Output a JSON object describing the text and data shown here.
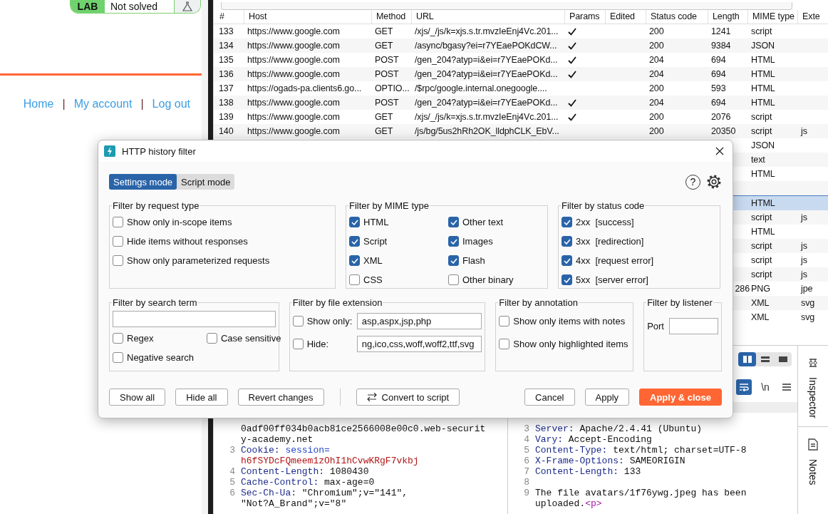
{
  "lab_banner": {
    "label": "LAB",
    "status": "Not solved"
  },
  "site_nav": [
    {
      "kind": "link",
      "label": "Home"
    },
    {
      "kind": "separator",
      "label": "|"
    },
    {
      "kind": "link",
      "label": "My account"
    },
    {
      "kind": "separator",
      "label": "|"
    },
    {
      "kind": "link",
      "label": "Log out"
    }
  ],
  "proxy_table": {
    "columns": [
      "#",
      "Host",
      "Method",
      "URL",
      "Params",
      "Edited",
      "Status code",
      "Length",
      "MIME type",
      "Exte"
    ],
    "rows": [
      {
        "num": "133",
        "host": "https://www.google.com",
        "method": "GET",
        "url": "/xjs/_/js/k=xjs.s.tr.mvzIeEnj4Vc.201...",
        "params": true,
        "status": "200",
        "length": "1241",
        "mime": "script",
        "selected": false
      },
      {
        "num": "134",
        "host": "https://www.google.com",
        "method": "GET",
        "url": "/async/bgasy?ei=r7YEaePOKdCW...",
        "params": true,
        "status": "200",
        "length": "9384",
        "mime": "JSON",
        "selected": false
      },
      {
        "num": "135",
        "host": "https://www.google.com",
        "method": "POST",
        "url": "/gen_204?atyp=i&ei=r7YEaePOKd...",
        "params": true,
        "status": "204",
        "length": "694",
        "mime": "HTML",
        "selected": false
      },
      {
        "num": "136",
        "host": "https://www.google.com",
        "method": "POST",
        "url": "/gen_204?atyp=i&ei=r7YEaePOKd...",
        "params": true,
        "status": "204",
        "length": "694",
        "mime": "HTML",
        "selected": false
      },
      {
        "num": "137",
        "host": "https://ogads-pa.clients6.go...",
        "method": "OPTIO...",
        "url": "/$rpc/google.internal.onegoogle....",
        "params": false,
        "status": "200",
        "length": "593",
        "mime": "HTML",
        "selected": false
      },
      {
        "num": "138",
        "host": "https://www.google.com",
        "method": "POST",
        "url": "/gen_204?atyp=i&ei=r7YEaePOKd...",
        "params": true,
        "status": "204",
        "length": "694",
        "mime": "HTML",
        "selected": false
      },
      {
        "num": "139",
        "host": "https://www.google.com",
        "method": "GET",
        "url": "/xjs/_/js/k=xjs.s.tr.mvzIeEnj4Vc.201...",
        "params": true,
        "status": "200",
        "length": "2076",
        "mime": "script",
        "selected": false
      },
      {
        "num": "140",
        "host": "https://www.google.com",
        "method": "GET",
        "url": "/js/bg/5us2hRh2OK_lldphCLK_EbV...",
        "params": false,
        "status": "200",
        "length": "20350",
        "mime": "script",
        "ext": "js",
        "selected": false
      },
      {
        "mime": "JSON",
        "selected": false
      },
      {
        "mime": "text",
        "selected": false
      },
      {
        "mime": "HTML",
        "selected": false
      },
      {
        "selected": false
      },
      {
        "mime": "HTML",
        "selected": true
      },
      {
        "mime": "script",
        "ext": "js",
        "selected": false
      },
      {
        "mime": "HTML",
        "selected": false
      },
      {
        "mime": "script",
        "ext": "js",
        "selected": false
      },
      {
        "mime": "script",
        "ext": "js",
        "selected": false
      },
      {
        "mime": "script",
        "ext": "js",
        "selected": false
      },
      {
        "length": "286",
        "mime": "PNG",
        "ext": "jpe",
        "selected": false
      },
      {
        "mime": "XML",
        "ext": "svg",
        "selected": false
      },
      {
        "mime": "XML",
        "ext": "svg",
        "selected": false
      }
    ]
  },
  "view_toolbar": [
    {
      "kind": "columns",
      "selected": true
    },
    {
      "kind": "rows",
      "selected": false
    },
    {
      "kind": "single",
      "selected": false
    }
  ],
  "editor_toolbar": [
    {
      "kind": "wrap",
      "selected": true
    },
    {
      "kind": "text",
      "label": "\\n",
      "selected": false
    },
    {
      "kind": "menu",
      "selected": false
    }
  ],
  "request_editor": {
    "lines": [
      {
        "parts": [
          {
            "kind": "value",
            "text": "0adf00ff034b0acb81ce2566008e00c0.web-securit"
          }
        ]
      },
      {
        "parts": [
          {
            "kind": "value",
            "text": "y-academy.net"
          }
        ]
      },
      {
        "num": "3",
        "parts": [
          {
            "kind": "key",
            "text": "Cookie:"
          },
          {
            "kind": "cookie_name",
            "text": " session="
          }
        ]
      },
      {
        "parts": [
          {
            "kind": "cookie_value",
            "text": "h6fSYDcFQmeem1zOhI1hCvwKRgF7vkbj"
          }
        ]
      },
      {
        "num": "4",
        "parts": [
          {
            "kind": "key",
            "text": "Content-Length:"
          },
          {
            "kind": "value",
            "text": " 1080430"
          }
        ]
      },
      {
        "num": "5",
        "parts": [
          {
            "kind": "key",
            "text": "Cache-Control:"
          },
          {
            "kind": "value",
            "text": " max-age=0"
          }
        ]
      },
      {
        "num": "6",
        "parts": [
          {
            "kind": "key",
            "text": "Sec-Ch-Ua:"
          },
          {
            "kind": "value",
            "text": " \"Chromium\";v=\"141\","
          }
        ]
      },
      {
        "parts": [
          {
            "kind": "value",
            "text": "\"Not?A_Brand\";v=\"8\""
          }
        ]
      }
    ]
  },
  "response_editor": {
    "lines": [
      {
        "num": "3",
        "parts": [
          {
            "kind": "key",
            "text": "Server:"
          },
          {
            "kind": "value",
            "text": " Apache/2.4.41 (Ubuntu)"
          }
        ]
      },
      {
        "num": "4",
        "parts": [
          {
            "kind": "key",
            "text": "Vary:"
          },
          {
            "kind": "value",
            "text": " Accept-Encoding"
          }
        ]
      },
      {
        "num": "5",
        "parts": [
          {
            "kind": "key",
            "text": "Content-Type:"
          },
          {
            "kind": "value",
            "text": " text/html; charset=UTF-8"
          }
        ]
      },
      {
        "num": "6",
        "parts": [
          {
            "kind": "key",
            "text": "X-Frame-Options:"
          },
          {
            "kind": "value",
            "text": " SAMEORIGIN"
          }
        ]
      },
      {
        "num": "7",
        "parts": [
          {
            "kind": "key",
            "text": "Content-Length:"
          },
          {
            "kind": "value",
            "text": " 133"
          }
        ]
      },
      {
        "num": "8"
      },
      {
        "num": "9",
        "parts": [
          {
            "kind": "value",
            "text": "The file avatars/1f76ywg.jpeg has been"
          }
        ]
      },
      {
        "parts": [
          {
            "kind": "value",
            "text": "uploaded."
          },
          {
            "kind": "tag",
            "text": "<p>"
          }
        ]
      }
    ]
  },
  "side_rail": [
    {
      "kind": "inspector",
      "label": "Inspector"
    },
    {
      "kind": "notes",
      "label": "Notes"
    }
  ],
  "filter_dialog": {
    "title": "HTTP history filter",
    "help": "?",
    "modes": [
      {
        "label": "Settings mode",
        "selected": true
      },
      {
        "label": "Script mode",
        "selected": false
      }
    ],
    "request_type": {
      "title": "Filter by request type",
      "options": [
        {
          "label": "Show only in-scope items",
          "checked": false
        },
        {
          "label": "Hide items without responses",
          "checked": false
        },
        {
          "label": "Show only parameterized requests",
          "checked": false
        }
      ]
    },
    "mime_type": {
      "title": "Filter by MIME type",
      "options": [
        {
          "label": "HTML",
          "checked": true
        },
        {
          "label": "Other text",
          "checked": true
        },
        {
          "label": "Script",
          "checked": true
        },
        {
          "label": "Images",
          "checked": true
        },
        {
          "label": "XML",
          "checked": true
        },
        {
          "label": "Flash",
          "checked": true
        },
        {
          "label": "CSS",
          "checked": false
        },
        {
          "label": "Other binary",
          "checked": false
        }
      ]
    },
    "status_code": {
      "title": "Filter by status code",
      "options": [
        {
          "label": "2xx  [success]",
          "checked": true
        },
        {
          "label": "3xx  [redirection]",
          "checked": true
        },
        {
          "label": "4xx  [request error]",
          "checked": true
        },
        {
          "label": "5xx  [server error]",
          "checked": true
        }
      ]
    },
    "search_term": {
      "title": "Filter by search term",
      "options": [
        {
          "label": "Regex",
          "checked": false
        },
        {
          "label": "Case sensitive",
          "checked": false
        },
        {
          "label": "Negative search",
          "checked": false
        }
      ]
    },
    "file_extension": {
      "title": "Filter by file extension",
      "rows": [
        {
          "label": "Show only:",
          "checked": false,
          "value": "asp,aspx,jsp,php"
        },
        {
          "label": "Hide:",
          "checked": false,
          "value": "ng,ico,css,woff,woff2,ttf,svg"
        }
      ]
    },
    "annotation": {
      "title": "Filter by annotation",
      "options": [
        {
          "label": "Show only items with notes",
          "checked": false
        },
        {
          "label": "Show only highlighted items",
          "checked": false
        }
      ]
    },
    "listener": {
      "title": "Filter by listener",
      "port_label": "Port"
    },
    "buttons": [
      {
        "kind": "default",
        "label": "Show all"
      },
      {
        "kind": "default",
        "label": "Hide all"
      },
      {
        "kind": "default",
        "label": "Revert changes"
      },
      {
        "kind": "convert",
        "label": "Convert to script"
      },
      {
        "kind": "default",
        "label": "Cancel"
      },
      {
        "kind": "default",
        "label": "Apply"
      },
      {
        "kind": "primary",
        "label": "Apply & close"
      }
    ]
  }
}
